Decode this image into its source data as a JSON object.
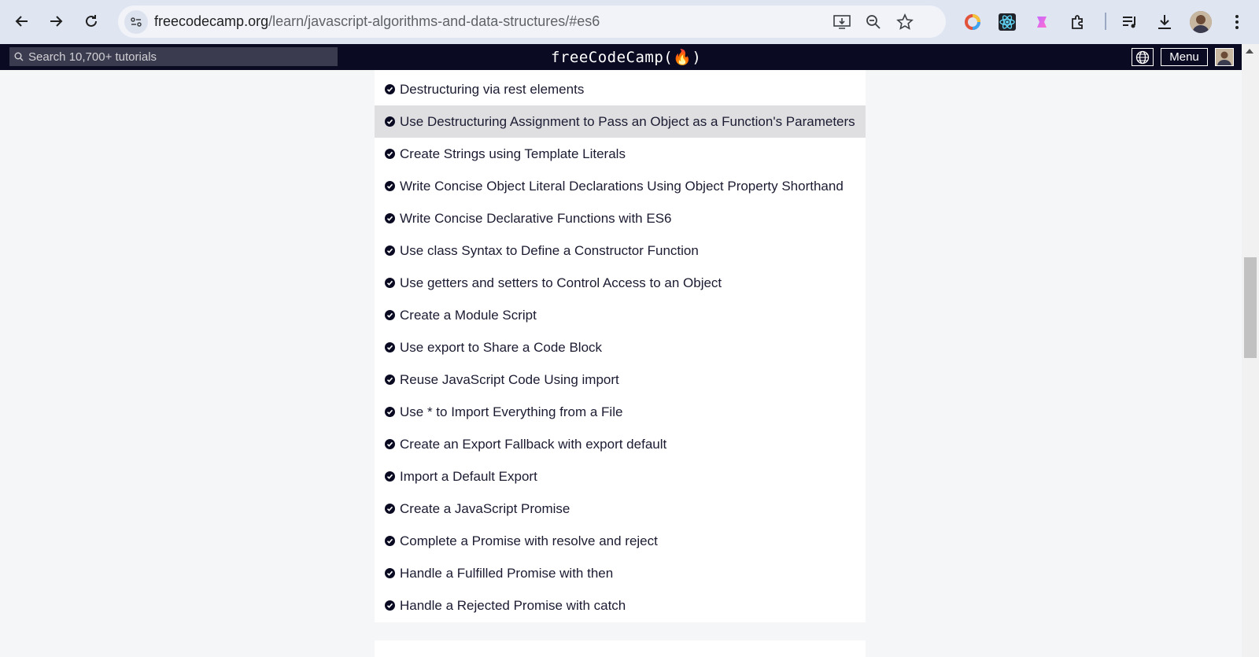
{
  "browser": {
    "url_domain": "freecodecamp.org",
    "url_path": "/learn/javascript-algorithms-and-data-structures/#es6",
    "icons": [
      "back-arrow-icon",
      "forward-arrow-icon",
      "reload-icon",
      "site-info-icon",
      "install-app-icon",
      "zoom-icon",
      "bookmark-star-icon",
      "color-wheel-extension-icon",
      "react-devtools-extension-icon",
      "gradient-extension-icon",
      "extensions-puzzle-icon",
      "media-control-icon",
      "downloads-icon",
      "profile-avatar",
      "kebab-menu-icon"
    ]
  },
  "fcc_nav": {
    "search_placeholder": "Search 10,700+ tutorials",
    "logo": "freeCodeCamp(🔥)",
    "menu_label": "Menu"
  },
  "lessons": [
    {
      "title": "Destructuring via rest elements",
      "completed": true
    },
    {
      "title": "Use Destructuring Assignment to Pass an Object as a Function's Parameters",
      "completed": true
    },
    {
      "title": "Create Strings using Template Literals",
      "completed": true
    },
    {
      "title": "Write Concise Object Literal Declarations Using Object Property Shorthand",
      "completed": true
    },
    {
      "title": "Write Concise Declarative Functions with ES6",
      "completed": true
    },
    {
      "title": "Use class Syntax to Define a Constructor Function",
      "completed": true
    },
    {
      "title": "Use getters and setters to Control Access to an Object",
      "completed": true
    },
    {
      "title": "Create a Module Script",
      "completed": true
    },
    {
      "title": "Use export to Share a Code Block",
      "completed": true
    },
    {
      "title": "Reuse JavaScript Code Using import",
      "completed": true
    },
    {
      "title": "Use * to Import Everything from a File",
      "completed": true
    },
    {
      "title": "Create an Export Fallback with export default",
      "completed": true
    },
    {
      "title": "Import a Default Export",
      "completed": true
    },
    {
      "title": "Create a JavaScript Promise",
      "completed": true
    },
    {
      "title": "Complete a Promise with resolve and reject",
      "completed": true
    },
    {
      "title": "Handle a Fulfilled Promise with then",
      "completed": true
    },
    {
      "title": "Handle a Rejected Promise with catch",
      "completed": true
    }
  ],
  "colors": {
    "nav_bg": "#0a0a23",
    "hover_row": "#dfdfe2",
    "text": "#1b1b32",
    "page_bg": "#f5f6f7",
    "chrome_bg": "#dfe6f2"
  }
}
